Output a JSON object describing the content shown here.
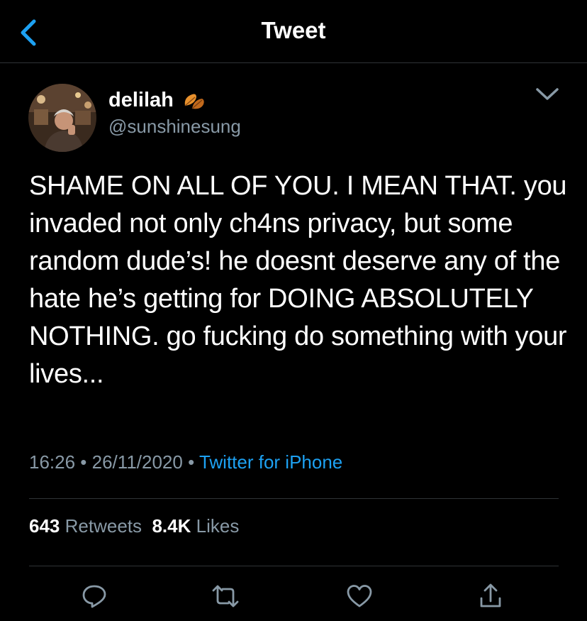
{
  "header": {
    "title": "Tweet"
  },
  "tweet": {
    "name": "delilah",
    "handle": "@sunshinesung",
    "text": "SHAME ON ALL OF YOU. I MEAN THAT. you invaded not only ch4ns privacy, but some random dude’s! he doesnt deserve any of the hate he’s getting for DOING ABSOLUTELY NOTHING. go fucking do something with your lives...",
    "time": "16:26",
    "date": "26/11/2020",
    "separator": " • ",
    "source": "Twitter for iPhone"
  },
  "stats": {
    "retweets_count": "643",
    "retweets_label": "Retweets",
    "likes_count": "8.4K",
    "likes_label": "Likes"
  },
  "icons": {
    "back": "chevron-left-icon",
    "leaf": "leaf-emoji-icon",
    "more": "chevron-down-icon",
    "reply": "reply-icon",
    "retweet": "retweet-icon",
    "like": "heart-icon",
    "share": "share-icon"
  },
  "colors": {
    "background": "#000000",
    "accent": "#1da1f2",
    "secondary_text": "#8899a6",
    "divider": "#2f3336"
  }
}
